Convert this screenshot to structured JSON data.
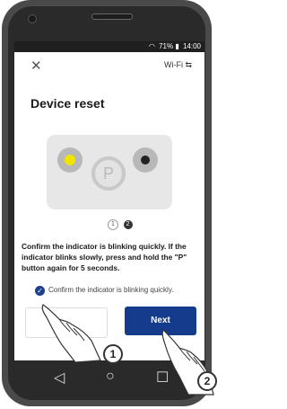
{
  "status": {
    "signal_text": "71%",
    "time": "14:00"
  },
  "top": {
    "close_glyph": "✕",
    "wifi_label": "Wi-Fi ⇆"
  },
  "page": {
    "title": "Device reset"
  },
  "device": {
    "p_label": "P"
  },
  "pager": {
    "page1": "1",
    "page2": "2"
  },
  "instructions": "Confirm the indicator is blinking quickly. If the indicator blinks slowly, press and hold the \"P\" button again for 5 seconds.",
  "confirm_checkbox": {
    "label": "Confirm the indicator is blinking quickly.",
    "checked": true
  },
  "buttons": {
    "next": "Next"
  },
  "nav": {
    "back": "◁",
    "home": "○",
    "recent": "☐"
  },
  "callouts": {
    "one": "1",
    "two": "2"
  }
}
